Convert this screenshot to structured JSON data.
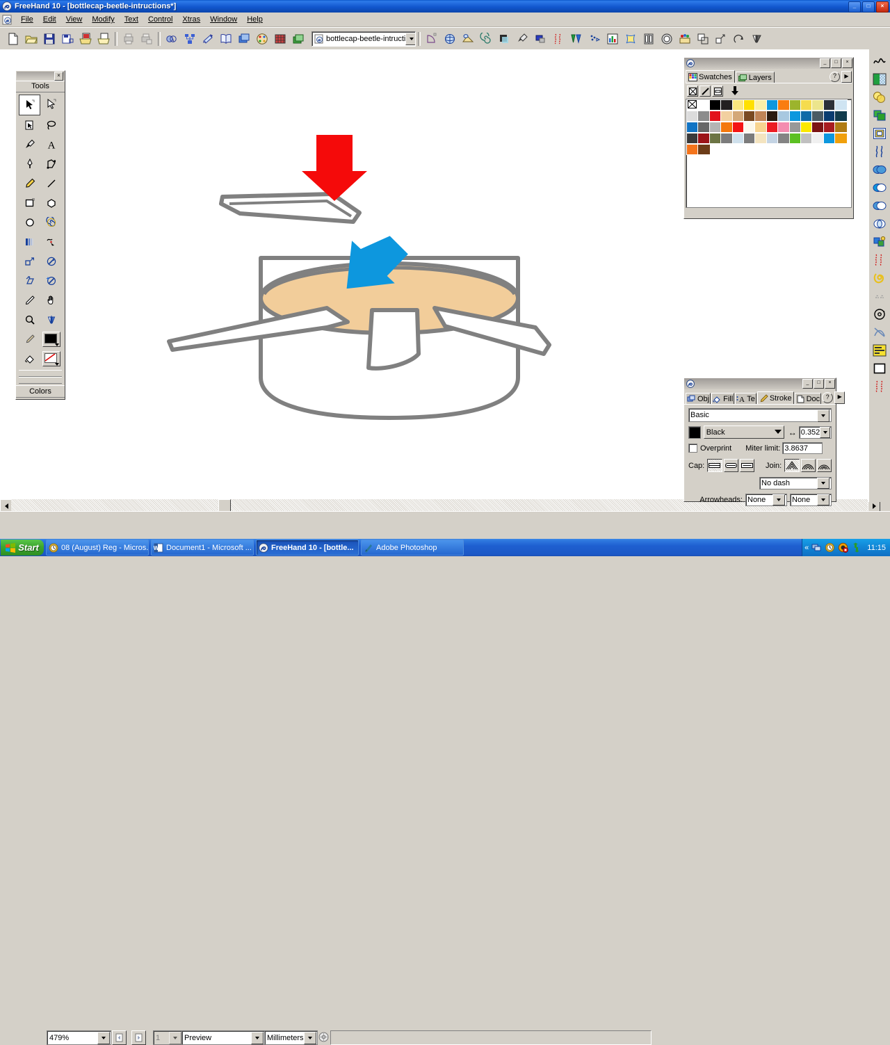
{
  "window": {
    "title": "FreeHand 10 - [bottlecap-beetle-intructions*]",
    "app_icon": "freehand-icon",
    "minimize_label": "_",
    "maximize_label": "□",
    "close_label": "×"
  },
  "menu": {
    "items": [
      {
        "label": "File",
        "accel": "F"
      },
      {
        "label": "Edit",
        "accel": "E"
      },
      {
        "label": "View",
        "accel": "V"
      },
      {
        "label": "Modify",
        "accel": "M"
      },
      {
        "label": "Text",
        "accel": "T"
      },
      {
        "label": "Control",
        "accel": "C"
      },
      {
        "label": "Xtras",
        "accel": "X"
      },
      {
        "label": "Window",
        "accel": "W"
      },
      {
        "label": "Help",
        "accel": "H"
      }
    ]
  },
  "toolbar": {
    "buttons": [
      {
        "name": "new-document-button",
        "icon": "page-icon"
      },
      {
        "name": "open-document-button",
        "icon": "folder-open-icon"
      },
      {
        "name": "save-document-button",
        "icon": "floppy-disk-icon"
      },
      {
        "name": "save-as-button",
        "icon": "save-as-icon"
      },
      {
        "name": "import-button",
        "icon": "import-icon"
      },
      {
        "name": "export-button",
        "icon": "export-icon"
      },
      {
        "name": "print-button",
        "icon": "print-icon"
      },
      {
        "name": "print-setup-button",
        "icon": "print-setup-icon"
      },
      {
        "name": "object-panel-button",
        "icon": "object-inspector-icon"
      },
      {
        "name": "align-panel-button",
        "icon": "align-icon"
      },
      {
        "name": "transform-panel-button",
        "icon": "transform-icon"
      },
      {
        "name": "library-panel-button",
        "icon": "library-icon"
      },
      {
        "name": "layers-panel-button",
        "icon": "layers-panel-icon"
      },
      {
        "name": "swatches-panel-button",
        "icon": "color-mixer-icon"
      },
      {
        "name": "grid-button",
        "icon": "grid-icon"
      },
      {
        "name": "stack-button",
        "icon": "stack-icon"
      }
    ],
    "xtras_buttons": [
      {
        "name": "xtra-arc-button",
        "icon": "arc-icon"
      },
      {
        "name": "xtra-3d-rotate-button",
        "icon": "3d-rotate-icon"
      },
      {
        "name": "xtra-fisheye-button",
        "icon": "fisheye-icon"
      },
      {
        "name": "xtra-spiral-button",
        "icon": "spiral-icon"
      },
      {
        "name": "xtra-shadow-button",
        "icon": "shadow-icon"
      },
      {
        "name": "xtra-eyedropper-button",
        "icon": "eyedropper-icon"
      },
      {
        "name": "xtra-emboss-button",
        "icon": "emboss-icon"
      },
      {
        "name": "xtra-roughen-button",
        "icon": "roughen-icon"
      },
      {
        "name": "xtra-blend-button",
        "icon": "blend-icon"
      },
      {
        "name": "xtra-trace-button",
        "icon": "trace-icon"
      },
      {
        "name": "xtra-chart-button",
        "icon": "chart-icon"
      },
      {
        "name": "xtra-envelope-button",
        "icon": "envelope-icon"
      },
      {
        "name": "xtra-mirror-button",
        "icon": "mirror-icon"
      },
      {
        "name": "xtra-ellipse-button",
        "icon": "ellipse-3d-icon"
      },
      {
        "name": "xtra-graphic-button",
        "icon": "graphic-hose-icon"
      },
      {
        "name": "xtra-expand-button",
        "icon": "expand-path-icon"
      },
      {
        "name": "xtra-extrude-button",
        "icon": "extrude-icon"
      },
      {
        "name": "xtra-inset-button",
        "icon": "inset-path-icon"
      },
      {
        "name": "xtra-reflect-button",
        "icon": "reflect-icon"
      }
    ],
    "document_combo": {
      "value": "bottlecap-beetle-intructi",
      "icon": "document-icon"
    }
  },
  "tools_panel": {
    "title": "Tools",
    "colors_title": "Colors",
    "close_label": "×",
    "tools": [
      {
        "name": "pointer-tool",
        "icon": "arrow-pointer-icon",
        "selected": true
      },
      {
        "name": "subselect-tool",
        "icon": "hollow-arrow-icon",
        "selected": false
      },
      {
        "name": "page-tool",
        "icon": "page-tool-icon",
        "selected": false
      },
      {
        "name": "lasso-tool",
        "icon": "lasso-icon",
        "selected": false
      },
      {
        "name": "eyedropper-tool",
        "icon": "eyedropper-icon",
        "selected": false
      },
      {
        "name": "text-tool",
        "icon": "text-a-icon",
        "selected": false
      },
      {
        "name": "pen-tool",
        "icon": "pen-nib-icon",
        "selected": false
      },
      {
        "name": "bezigon-tool",
        "icon": "bezigon-icon",
        "selected": false
      },
      {
        "name": "pencil-tool",
        "icon": "pencil-icon",
        "selected": false
      },
      {
        "name": "line-tool",
        "icon": "line-icon",
        "selected": false
      },
      {
        "name": "rectangle-tool",
        "icon": "rectangle-icon",
        "selected": false
      },
      {
        "name": "polygon-tool",
        "icon": "polygon-icon",
        "selected": false
      },
      {
        "name": "ellipse-tool",
        "icon": "ellipse-icon",
        "selected": false
      },
      {
        "name": "spiral-tool",
        "icon": "spiral-icon",
        "selected": false
      },
      {
        "name": "blend-tool",
        "icon": "blend-bars-icon",
        "selected": false
      },
      {
        "name": "freeform-tool",
        "icon": "freeform-icon",
        "selected": false
      },
      {
        "name": "scale-tool",
        "icon": "scale-icon",
        "selected": false
      },
      {
        "name": "rotate-tool",
        "icon": "rotate-icon",
        "selected": false
      },
      {
        "name": "skew-tool",
        "icon": "skew-icon",
        "selected": false
      },
      {
        "name": "trace-tool",
        "icon": "magic-wand-icon",
        "selected": false
      },
      {
        "name": "knife-tool",
        "icon": "knife-icon",
        "selected": false
      },
      {
        "name": "hand-tool",
        "icon": "hand-icon",
        "selected": false
      },
      {
        "name": "zoom-tool",
        "icon": "magnifier-icon",
        "selected": false
      },
      {
        "name": "mirror-tool",
        "icon": "mirror-icon",
        "selected": false
      },
      {
        "name": "eyedrop-color-tool",
        "icon": "color-dropper-icon",
        "selected": false
      },
      {
        "name": "fill-color-well",
        "icon": "fill-swatch-icon",
        "selected": false
      },
      {
        "name": "paint-bucket-tool",
        "icon": "paint-bucket-icon",
        "selected": false
      },
      {
        "name": "stroke-color-well",
        "icon": "stroke-swatch-icon",
        "selected": false
      }
    ]
  },
  "swatches_panel": {
    "tabs": [
      {
        "label": "Swatches",
        "icon": "swatches-icon",
        "active": true
      },
      {
        "label": "Layers",
        "icon": "layers-icon",
        "active": false
      }
    ],
    "help_label": "?",
    "options_label": "▶",
    "minimize_label": "_",
    "maximize_label": "□",
    "close_label": "×",
    "mode_buttons": [
      {
        "name": "none-fill-button",
        "icon": "none-x-icon"
      },
      {
        "name": "stroke-only-button",
        "icon": "stroke-slash-icon"
      },
      {
        "name": "fill-only-button",
        "icon": "fill-square-icon"
      },
      {
        "name": "apply-down-button",
        "icon": "down-arrow-icon"
      }
    ],
    "colors": [
      "none",
      "#ffffff",
      "#000000",
      "#231f20",
      "#fbe77f",
      "#ffe000",
      "#fbf0a8",
      "#0d97de",
      "#f97d10",
      "#9cb42c",
      "#f5dc4e",
      "#ece58c",
      "#2c3138",
      "#cfe4f2",
      "#dcdcdc",
      "#8c8c8c",
      "#e2131b",
      "#f2d0a0",
      "#d4a878",
      "#7a4a22",
      "#c08457",
      "#2a1a10",
      "#a8c8e0",
      "#0d97de",
      "#0f6aa8",
      "#4a5a64",
      "#0a3c70",
      "#123c4c",
      "#1174c4",
      "#676767",
      "#b4b4b4",
      "#f4780c",
      "#f41414",
      "#fcf8ec",
      "#f8d490",
      "#ec1c24",
      "#f48cb0",
      "#989898",
      "#fbe800",
      "#7c1414",
      "#a81c20",
      "#b07c14",
      "#3a3a3a",
      "#9c1418",
      "#6c7444",
      "#7c7c7c",
      "#cfe0ec",
      "#7c7c7c",
      "#f4e4c0",
      "#c4d4e4",
      "#848484",
      "#5cc022",
      "#c0c0c0",
      "#f0f0f0",
      "#0d97de",
      "#f0a00c",
      "#f4741c",
      "#6c3c18"
    ]
  },
  "stroke_panel": {
    "tabs": [
      {
        "label": "Obj",
        "icon": "object-icon",
        "active": false
      },
      {
        "label": "Fill",
        "icon": "fill-icon",
        "active": false
      },
      {
        "label": "Te",
        "icon": "text-icon",
        "active": false
      },
      {
        "label": "Stroke",
        "icon": "stroke-icon",
        "active": true
      },
      {
        "label": "Doc",
        "icon": "document-icon",
        "active": false
      }
    ],
    "help_label": "?",
    "options_label": "▶",
    "minimize_label": "_",
    "maximize_label": "□",
    "close_label": "×",
    "stroke_type": "Basic",
    "color_name": "Black",
    "color_hex": "#000000",
    "width_label": "↔",
    "width_value": "0.352",
    "overprint_label": "Overprint",
    "overprint_checked": false,
    "miter_limit_label": "Miter limit:",
    "miter_limit_value": "3.8637",
    "cap_label": "Cap:",
    "cap_options": [
      {
        "name": "cap-butt-button",
        "selected": true
      },
      {
        "name": "cap-round-button",
        "selected": false
      },
      {
        "name": "cap-square-button",
        "selected": false
      }
    ],
    "join_label": "Join:",
    "join_options": [
      {
        "name": "join-miter-button",
        "selected": true
      },
      {
        "name": "join-round-button",
        "selected": false
      },
      {
        "name": "join-bevel-button",
        "selected": false
      }
    ],
    "dash_value": "No dash",
    "arrowheads_label": "Arrowheads:",
    "arrowhead_start": "None",
    "arrowhead_end": "None"
  },
  "edge_toolbar": {
    "buttons": [
      {
        "name": "path-operations-icon"
      },
      {
        "name": "gradient-fill-icon"
      },
      {
        "name": "transparency-icon"
      },
      {
        "name": "duplicate-icon"
      },
      {
        "name": "inset-path-icon"
      },
      {
        "name": "roughen-icon"
      },
      {
        "name": "union-icon"
      },
      {
        "name": "divide-icon"
      },
      {
        "name": "intersect-icon"
      },
      {
        "name": "punch-icon"
      },
      {
        "name": "blend-objects-icon"
      },
      {
        "name": "trap-icon"
      },
      {
        "name": "crop-icon"
      },
      {
        "name": "expand-stroke-icon"
      },
      {
        "name": "simplify-icon"
      },
      {
        "name": "rotate-around-icon"
      },
      {
        "name": "correct-direction-icon"
      },
      {
        "name": "align-objects-icon"
      },
      {
        "name": "rectangle-shape-icon"
      },
      {
        "name": "fractalize-icon"
      }
    ]
  },
  "status_bar": {
    "zoom_value": "479%",
    "prev_page_icon": "prev-page-icon",
    "next_page_icon": "next-page-icon",
    "page_value": "1",
    "view_mode": "Preview",
    "units": "Millimeters",
    "animate_icon": "animate-icon",
    "message": ""
  },
  "taskbar": {
    "start_label": "Start",
    "items": [
      {
        "label": "08 (August) Reg - Micros...",
        "icon": "outlook-icon",
        "active": false
      },
      {
        "label": "Document1 - Microsoft ...",
        "icon": "word-icon",
        "active": false
      },
      {
        "label": "FreeHand 10 - [bottle...",
        "icon": "freehand-icon",
        "active": true
      },
      {
        "label": "Adobe Photoshop",
        "icon": "photoshop-icon",
        "active": false
      }
    ],
    "tray": {
      "expand_label": "«",
      "icons": [
        "network-icon",
        "clock-yellow-icon",
        "antivirus-icon",
        "updates-icon"
      ],
      "clock": "11:15"
    }
  },
  "artwork": {
    "description": "Exploded assembly illustration of a bottlecap beetle: a flat rectangular plate above, a beige domed cap body with three white paddle legs, and a white cylindrical bottlecap beneath.",
    "colors": {
      "outline": "#808080",
      "body_fill": "#f2cd9a",
      "paper_fill": "#ffffff",
      "arrow_red": "#f50a0a",
      "arrow_blue": "#0d97de"
    },
    "arrows": [
      {
        "name": "red-down-arrow",
        "color": "#f50a0a"
      },
      {
        "name": "blue-down-arrow",
        "color": "#0d97de"
      }
    ]
  }
}
